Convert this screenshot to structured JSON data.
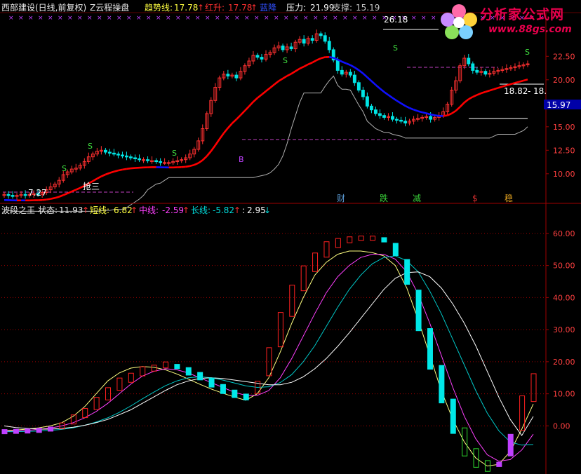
{
  "header": {
    "stock": "西部建设(日线,前复权)",
    "indicator": "Z云程操盘",
    "trend_label": "趋势线:",
    "trend_value": "17.78",
    "trend_arrow": "↑",
    "red_label": "红升:",
    "red_value": "17.78",
    "red_arrow": "↑",
    "blue_label": "蓝降",
    "pressure_label": "压力:",
    "pressure_value": "21.99",
    "support_label": "支撑:",
    "support_value": "15.19"
  },
  "sub_header": {
    "name": "波段之王",
    "state_label": "状态:",
    "state_value": "11.93",
    "state_arrow": "↑",
    "short_label": "短线:",
    "short_value": "6.82",
    "short_arrow": "↑",
    "mid_label": "中线:",
    "mid_value": "-2.59",
    "mid_arrow": "↑",
    "long_label": "长线:",
    "long_value": "-5.82",
    "long_arrow": "↑",
    "extra_label": ":",
    "extra_value": "2.95",
    "extra_arrow": "↓"
  },
  "logo": {
    "title": "分析家公式网",
    "url": "www.88gs.com"
  },
  "annotations": {
    "high": "26.18",
    "low": "7.27",
    "buy_tag": "抢三",
    "level_left": "18.82",
    "level_right": "18.",
    "current_price": "15.97",
    "s_marker": "S",
    "b_marker": "B"
  },
  "events": [
    {
      "label": "财",
      "color": "#5b9bd5"
    },
    {
      "label": "跌",
      "color": "#3ad23a"
    },
    {
      "label": "减",
      "color": "#3ad23a"
    },
    {
      "label": "$",
      "color": "#e03030"
    },
    {
      "label": "稳",
      "color": "#e0a020"
    }
  ],
  "colors": {
    "up": "#ff3030",
    "down": "#00e4e4",
    "trend_up": "#ff0000",
    "trend_down": "#1010ff",
    "grid": "#a00000",
    "axis_text": "#ff4040",
    "short": "#ffff80",
    "mid": "#ff40ff",
    "long": "#00c8c8",
    "base": "#ffffff"
  },
  "chart_data": [
    {
      "type": "candlestick",
      "title": "西部建设(日线,前复权)",
      "ylabel": "",
      "ylim": [
        7,
        27
      ],
      "y_ticks": [
        "10.00",
        "12.50",
        "15.00",
        "17.50",
        "20.00",
        "22.50"
      ],
      "x": [
        1,
        2,
        3,
        4,
        5,
        6,
        7,
        8,
        9,
        10,
        11,
        12,
        13,
        14,
        15,
        16,
        17,
        18,
        19,
        20,
        21,
        22,
        23,
        24,
        25,
        26,
        27,
        28,
        29,
        30,
        31,
        32,
        33,
        34,
        35,
        36,
        37,
        38,
        39,
        40,
        41,
        42,
        43,
        44,
        45,
        46,
        47,
        48,
        48,
        49,
        50,
        51,
        52,
        53,
        54,
        55,
        56,
        57,
        58,
        59,
        60,
        61,
        62,
        63,
        64,
        65,
        66,
        67,
        68,
        69,
        70,
        71,
        72,
        73,
        74,
        75,
        76,
        77,
        78,
        79,
        80,
        81,
        82,
        83,
        84,
        85,
        86,
        87,
        88,
        89,
        90,
        91,
        92,
        93,
        94,
        95,
        96,
        97,
        98,
        99,
        100,
        101,
        102,
        103,
        104,
        105,
        106,
        107,
        108,
        109,
        110,
        111,
        112,
        113,
        114,
        115,
        116,
        117,
        118,
        119,
        120,
        121,
        122,
        123,
        124,
        125
      ],
      "close": [
        7.8,
        7.7,
        7.6,
        7.7,
        7.8,
        7.7,
        7.8,
        7.9,
        7.8,
        8.0,
        8.3,
        8.6,
        8.9,
        9.3,
        9.9,
        10.2,
        10.5,
        10.6,
        10.9,
        11.3,
        11.8,
        12.1,
        12.4,
        12.5,
        12.3,
        12.2,
        12.1,
        12.0,
        11.9,
        11.8,
        11.7,
        11.6,
        11.5,
        11.5,
        11.4,
        11.4,
        11.3,
        11.2,
        11.2,
        11.2,
        11.3,
        11.4,
        11.5,
        11.7,
        12.1,
        12.6,
        13.5,
        14.8,
        16.4,
        17.8,
        19.2,
        20.2,
        20.6,
        20.4,
        20.5,
        20.2,
        20.9,
        21.5,
        22.0,
        22.6,
        22.4,
        22.2,
        22.7,
        22.9,
        23.4,
        23.6,
        23.2,
        23.5,
        23.3,
        24.0,
        24.3,
        23.9,
        24.4,
        24.2,
        24.9,
        24.7,
        24.1,
        23.2,
        22.1,
        21.0,
        20.6,
        20.8,
        20.5,
        19.7,
        18.9,
        18.2,
        17.2,
        16.8,
        16.4,
        16.2,
        16.0,
        16.1,
        15.8,
        15.7,
        15.6,
        15.4,
        15.6,
        15.8,
        15.9,
        16.0,
        16.1,
        15.8,
        16.0,
        16.2,
        16.6,
        17.4,
        18.9,
        19.9,
        21.5,
        22.3,
        21.7,
        21.0,
        20.8,
        20.9,
        20.6,
        20.7,
        20.9,
        21.0,
        21.1,
        21.2,
        21.3,
        21.4,
        21.5,
        21.6,
        21.7
      ]
    },
    {
      "type": "line",
      "title": "波段之王",
      "ylim": [
        -15,
        65
      ],
      "y_ticks": [
        "0.00",
        "10.00",
        "20.00",
        "30.00",
        "40.00",
        "50.00",
        "60.00"
      ],
      "series": [
        {
          "name": "短线",
          "values": [
            -1.5,
            -1.3,
            -1.0,
            -0.6,
            0.0,
            1.0,
            3.0,
            6.0,
            10.0,
            14.0,
            16.5,
            18.0,
            18.5,
            18.3,
            17.5,
            16.2,
            14.6,
            13.0,
            11.5,
            10.2,
            9.0,
            8.0,
            10.0,
            15.0,
            23.0,
            32.0,
            40.0,
            47.0,
            51.0,
            53.5,
            54.5,
            54.5,
            54.0,
            53.0,
            50.0,
            43.0,
            33.0,
            22.0,
            11.0,
            2.0,
            -5.0,
            -10.0,
            -12.5,
            -12.0,
            -8.0,
            -1.0,
            6.82
          ]
        },
        {
          "name": "中线",
          "values": [
            -1.7,
            -1.6,
            -1.4,
            -1.1,
            -0.7,
            0.0,
            1.0,
            2.5,
            4.5,
            7.0,
            10.0,
            13.0,
            15.5,
            17.0,
            17.8,
            17.5,
            16.5,
            15.0,
            13.5,
            12.0,
            10.5,
            9.5,
            9.5,
            11.0,
            15.0,
            21.0,
            28.0,
            35.0,
            41.5,
            46.5,
            50.0,
            52.5,
            53.5,
            53.5,
            52.0,
            48.0,
            41.0,
            32.0,
            22.0,
            12.0,
            3.0,
            -4.0,
            -9.0,
            -11.0,
            -10.5,
            -7.5,
            -2.59
          ]
        },
        {
          "name": "长线",
          "values": [
            -1.8,
            -1.8,
            -1.7,
            -1.6,
            -1.4,
            -1.1,
            -0.6,
            0.2,
            1.2,
            2.5,
            4.2,
            6.2,
            8.4,
            10.5,
            12.5,
            14.0,
            15.0,
            15.3,
            15.0,
            14.3,
            13.4,
            12.5,
            12.0,
            12.2,
            13.5,
            16.0,
            20.0,
            25.0,
            31.0,
            37.0,
            42.5,
            47.0,
            50.5,
            52.5,
            53.0,
            51.5,
            48.0,
            42.0,
            35.0,
            27.0,
            19.0,
            11.0,
            4.0,
            -1.5,
            -5.0,
            -6.0,
            -5.82
          ]
        },
        {
          "name": "",
          "values": [
            0.0,
            -0.5,
            -0.8,
            -1.0,
            -1.0,
            -0.8,
            -0.4,
            0.2,
            1.0,
            2.0,
            3.5,
            5.0,
            7.0,
            9.0,
            11.0,
            12.8,
            14.0,
            14.8,
            15.0,
            14.8,
            14.3,
            13.8,
            13.3,
            12.8,
            12.8,
            13.6,
            15.3,
            17.8,
            21.0,
            24.8,
            29.0,
            33.5,
            38.0,
            42.5,
            46.0,
            47.8,
            48.0,
            46.5,
            43.0,
            38.0,
            32.0,
            25.0,
            17.0,
            9.0,
            2.0,
            -3.0,
            2.95
          ]
        }
      ],
      "state": [
        -1.8,
        -1.7,
        -1.6,
        -1.4,
        -1.0,
        0.0,
        2.0,
        4.0,
        7.0,
        10.0,
        13.0,
        15.0,
        17.0,
        18.0,
        19.0,
        18.5,
        17.0,
        15.5,
        13.5,
        11.5,
        10.0,
        9.0,
        12.0,
        20.0,
        30.0,
        39.0,
        46.0,
        51.0,
        55.0,
        57.0,
        58.0,
        58.5,
        58.5,
        58.0,
        55.0,
        48.0,
        36.0,
        24.0,
        13.0,
        3.0,
        -5.0,
        -10.0,
        -12.5,
        -12.0,
        -6.0,
        4.0,
        11.93
      ]
    }
  ]
}
